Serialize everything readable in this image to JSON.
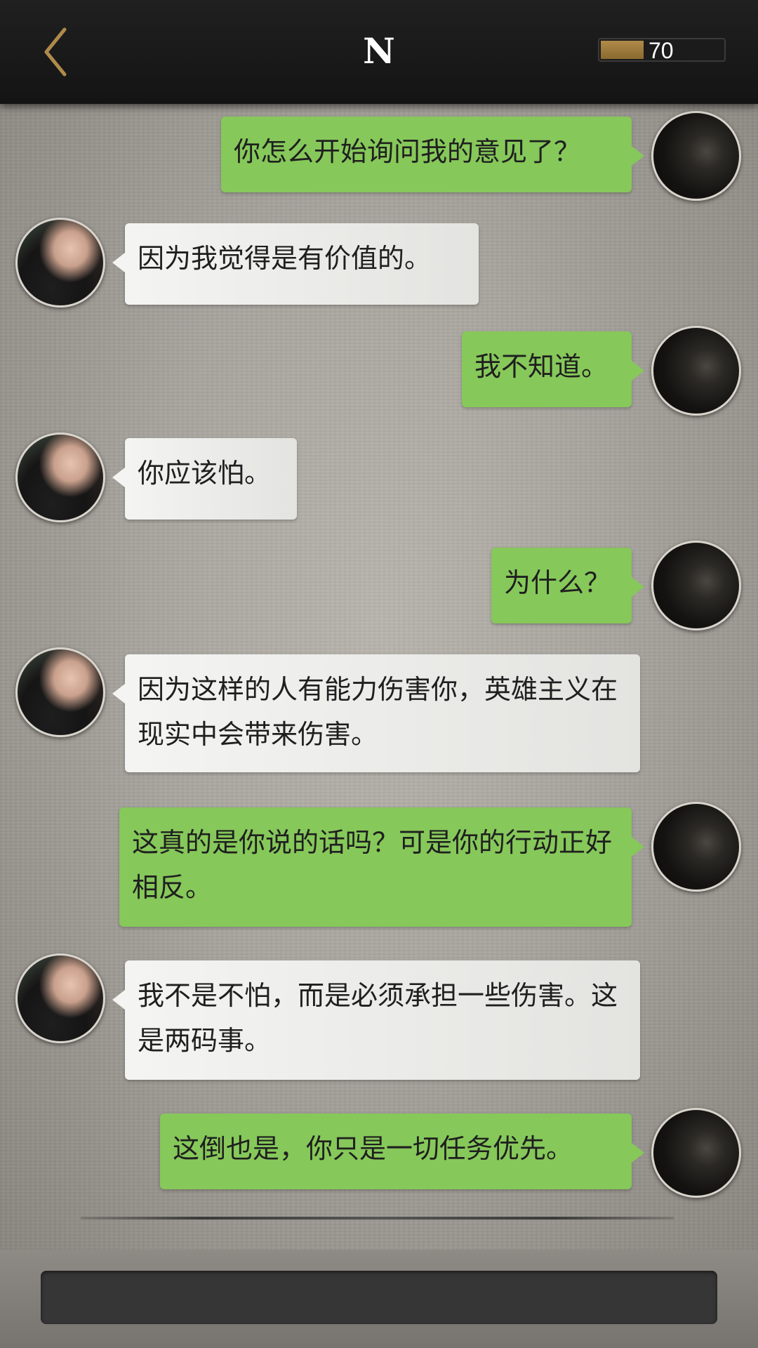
{
  "header": {
    "title": "N",
    "energy_value": "70",
    "energy_fraction": 0.35
  },
  "messages": [
    {
      "side": "out",
      "text": "你怎么开始询问我的意见了？"
    },
    {
      "side": "in",
      "text": "因为我觉得是有价值的。"
    },
    {
      "side": "out",
      "text": "我不知道。"
    },
    {
      "side": "in",
      "text": "你应该怕。"
    },
    {
      "side": "out",
      "text": "为什么？"
    },
    {
      "side": "in",
      "text": "因为这样的人有能力伤害你，英雄主义在现实中会带来伤害。"
    },
    {
      "side": "out",
      "text": "这真的是你说的话吗？可是你的行动正好相反。"
    },
    {
      "side": "in",
      "text": "我不是不怕，而是必须承担一些伤害。这是两码事。"
    },
    {
      "side": "out",
      "text": "这倒也是，你只是一切任务优先。"
    }
  ],
  "icons": {
    "back": "chevron-left-icon",
    "energy": "energy-bar-icon"
  },
  "colors": {
    "outgoing_bubble": "#86c85a",
    "incoming_bubble": "#f4f4f2",
    "back_arrow": "#b08a4a"
  }
}
